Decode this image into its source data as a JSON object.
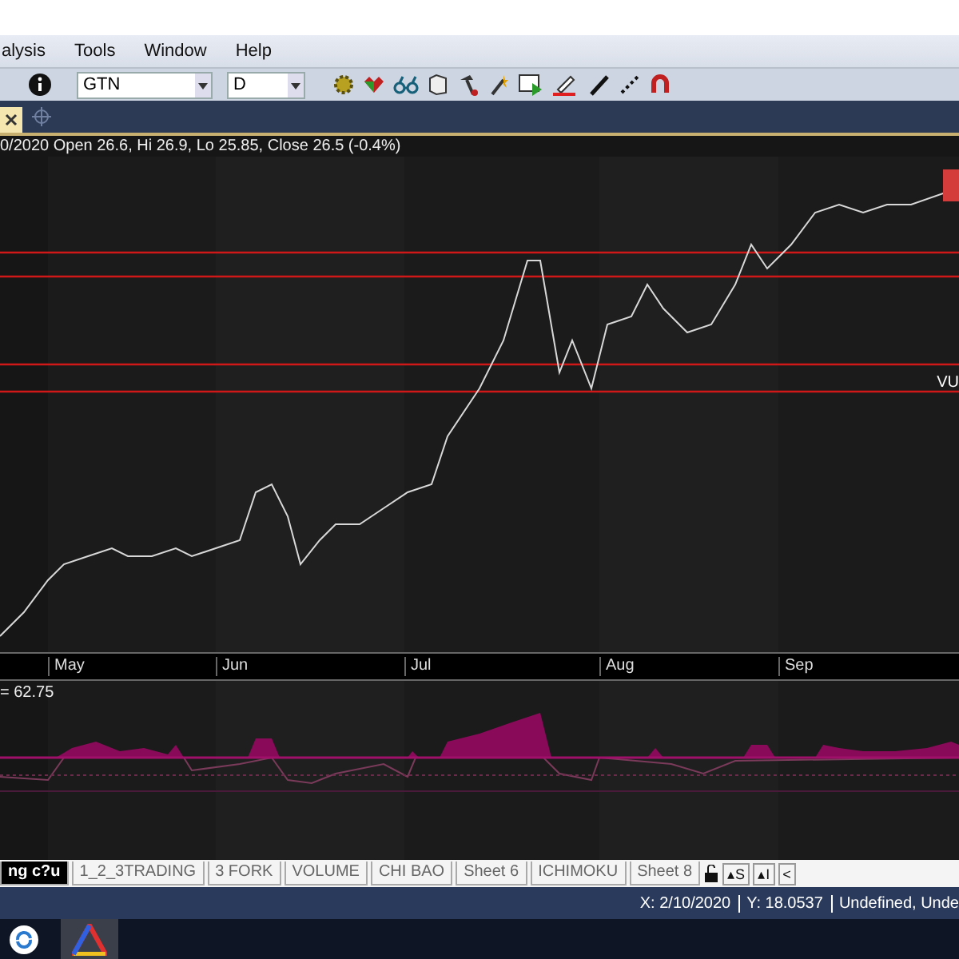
{
  "menu": [
    "alysis",
    "Tools",
    "Window",
    "Help"
  ],
  "toolbar": {
    "symbol": "GTN",
    "period": "D"
  },
  "chart": {
    "header": "0/2020 Open 26.6, Hi 26.9, Lo 25.85, Close 26.5 (-0.4%)",
    "right_label": "VU",
    "months": [
      "May",
      "Jun",
      "Jul",
      "Aug",
      "Sep"
    ],
    "indicator_label": "= 62.75"
  },
  "sheets": [
    {
      "label": "ng c?u",
      "selected": true
    },
    {
      "label": "1_2_3TRADING",
      "selected": false
    },
    {
      "label": "3 FORK",
      "selected": false
    },
    {
      "label": "VOLUME",
      "selected": false
    },
    {
      "label": "CHI BAO",
      "selected": false
    },
    {
      "label": "Sheet 6",
      "selected": false
    },
    {
      "label": "ICHIMOKU",
      "selected": false
    },
    {
      "label": "Sheet 8",
      "selected": false
    }
  ],
  "sheet_nav": [
    "▴S",
    "▴I",
    "<"
  ],
  "status": [
    "X: 2/10/2020",
    "Y: 18.0537",
    "Undefined, Unde"
  ]
}
